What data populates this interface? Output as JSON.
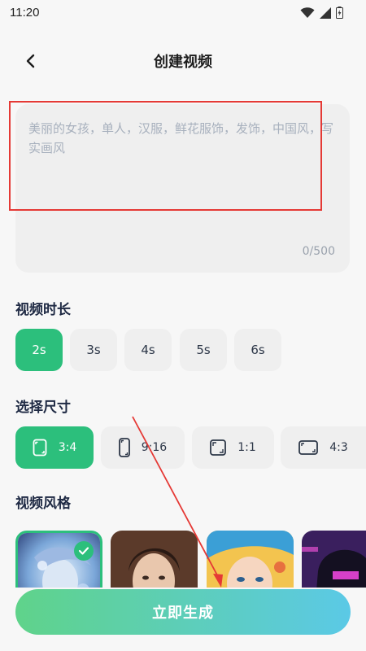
{
  "status": {
    "time": "11:20"
  },
  "header": {
    "title": "创建视频"
  },
  "prompt": {
    "placeholder": "美丽的女孩，单人，汉服，鲜花服饰，发饰，中国风，写实画风",
    "counter": "0/500"
  },
  "duration": {
    "title": "视频时长",
    "options": [
      "2s",
      "3s",
      "4s",
      "5s",
      "6s"
    ],
    "selected": "2s"
  },
  "size": {
    "title": "选择尺寸",
    "options": [
      "3:4",
      "9:16",
      "1:1",
      "4:3"
    ],
    "selected": "3:4"
  },
  "style": {
    "title": "视频风格",
    "thumbnails": [
      "style-1",
      "style-2",
      "style-3",
      "style-4"
    ],
    "selected": "style-1"
  },
  "generate": {
    "label": "立即生成"
  },
  "colors": {
    "accent": "#2cbf7c",
    "annotation": "#e53935"
  }
}
